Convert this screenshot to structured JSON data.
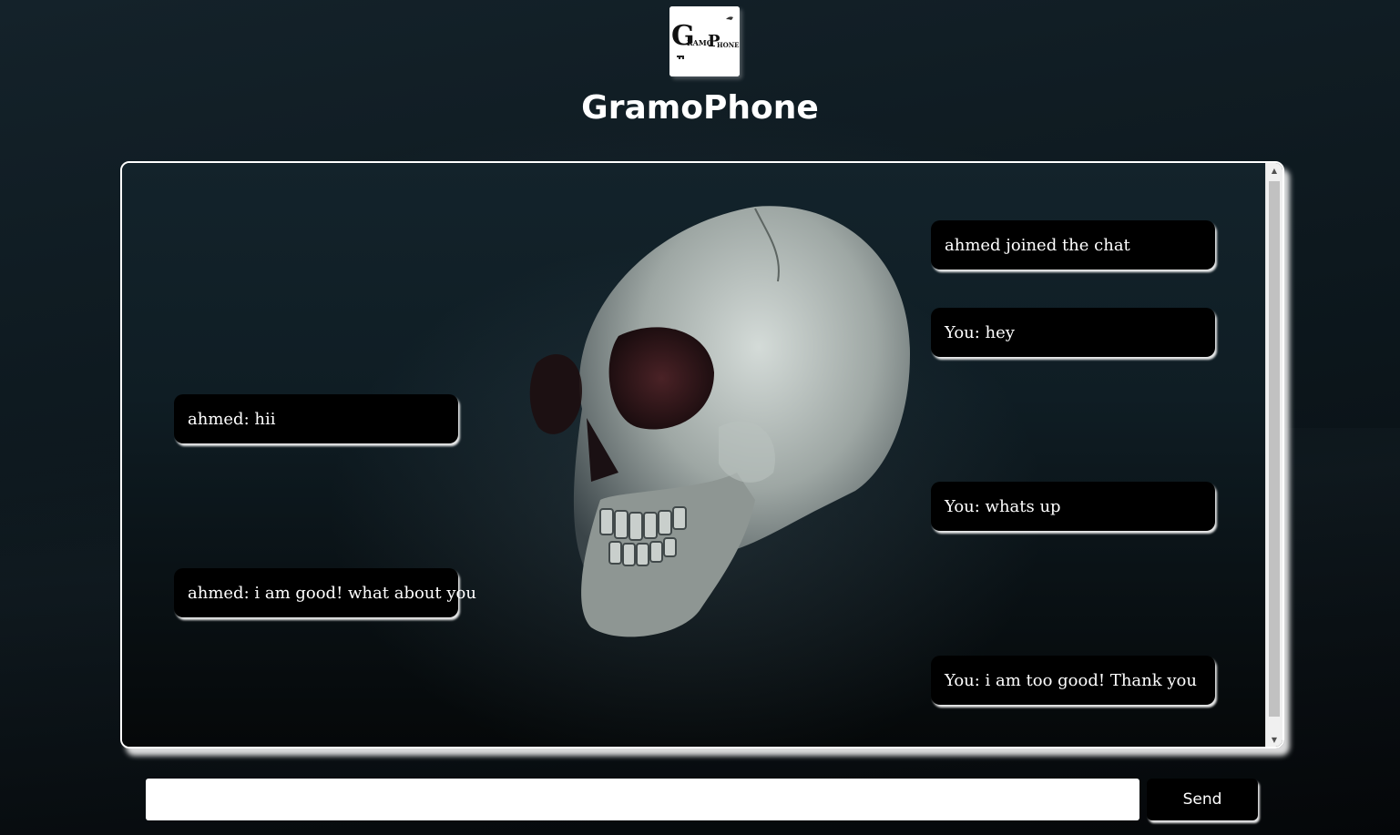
{
  "app": {
    "title": "GramoPhone",
    "logo": {
      "icon": "gramophone-logo",
      "text_big_g": "G",
      "text_ramo": "RAMO",
      "text_big_p": "P",
      "text_hone": "HONE"
    }
  },
  "chat": {
    "messages": [
      {
        "side": "right",
        "text": "ahmed joined the chat"
      },
      {
        "side": "right",
        "text": "You: hey"
      },
      {
        "side": "left",
        "text": "ahmed: hii"
      },
      {
        "side": "right",
        "text": "You: whats up"
      },
      {
        "side": "left",
        "text": "ahmed: i am good! what about you"
      },
      {
        "side": "right",
        "text": "You: i am too good! Thank you"
      }
    ],
    "background_image": "skull-photo"
  },
  "composer": {
    "input_value": "",
    "input_placeholder": "",
    "send_label": "Send"
  },
  "colors": {
    "message_bg": "#000000",
    "message_text": "#ffffff",
    "panel_border": "#ffffff"
  }
}
